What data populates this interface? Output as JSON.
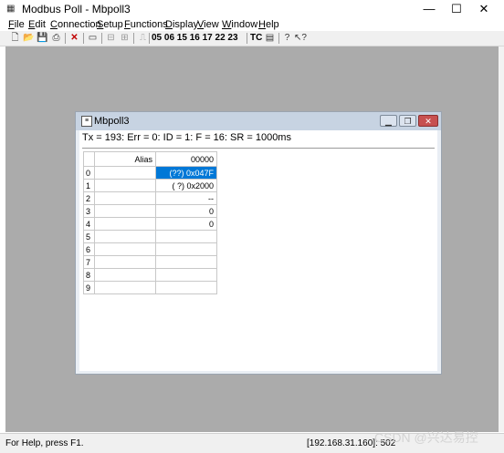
{
  "window": {
    "title": "Modbus Poll - Mbpoll3",
    "minimize": "—",
    "maximize": "☐",
    "close": "✕"
  },
  "menu": [
    {
      "ul": "F",
      "rest": "ile"
    },
    {
      "ul": "E",
      "rest": "dit"
    },
    {
      "ul": "C",
      "rest": "onnection"
    },
    {
      "ul": "S",
      "rest": "etup"
    },
    {
      "ul": "F",
      "rest": "unctions"
    },
    {
      "ul": "D",
      "rest": "isplay"
    },
    {
      "ul": "V",
      "rest": "iew"
    },
    {
      "ul": "W",
      "rest": "indow"
    },
    {
      "ul": "H",
      "rest": "elp"
    }
  ],
  "toolbar": {
    "function_codes": "05 06 15 16 17 22 23",
    "tc": "TC"
  },
  "child": {
    "title": "Mbpoll3",
    "status": "Tx = 193: Err = 0: ID = 1: F = 16: SR = 1000ms",
    "grid": {
      "col_alias": "Alias",
      "col_value": "00000",
      "rows": [
        {
          "n": "0",
          "alias": "",
          "value": "(??) 0x047F"
        },
        {
          "n": "1",
          "alias": "",
          "value": "( ?) 0x2000"
        },
        {
          "n": "2",
          "alias": "",
          "value": "--"
        },
        {
          "n": "3",
          "alias": "",
          "value": "0"
        },
        {
          "n": "4",
          "alias": "",
          "value": "0"
        },
        {
          "n": "5",
          "alias": "",
          "value": ""
        },
        {
          "n": "6",
          "alias": "",
          "value": ""
        },
        {
          "n": "7",
          "alias": "",
          "value": ""
        },
        {
          "n": "8",
          "alias": "",
          "value": ""
        },
        {
          "n": "9",
          "alias": "",
          "value": ""
        }
      ]
    }
  },
  "statusbar": {
    "help": "For Help, press F1.",
    "ip": "[192.168.31.160]: 502"
  },
  "watermark": "CSDN @兴达易控"
}
